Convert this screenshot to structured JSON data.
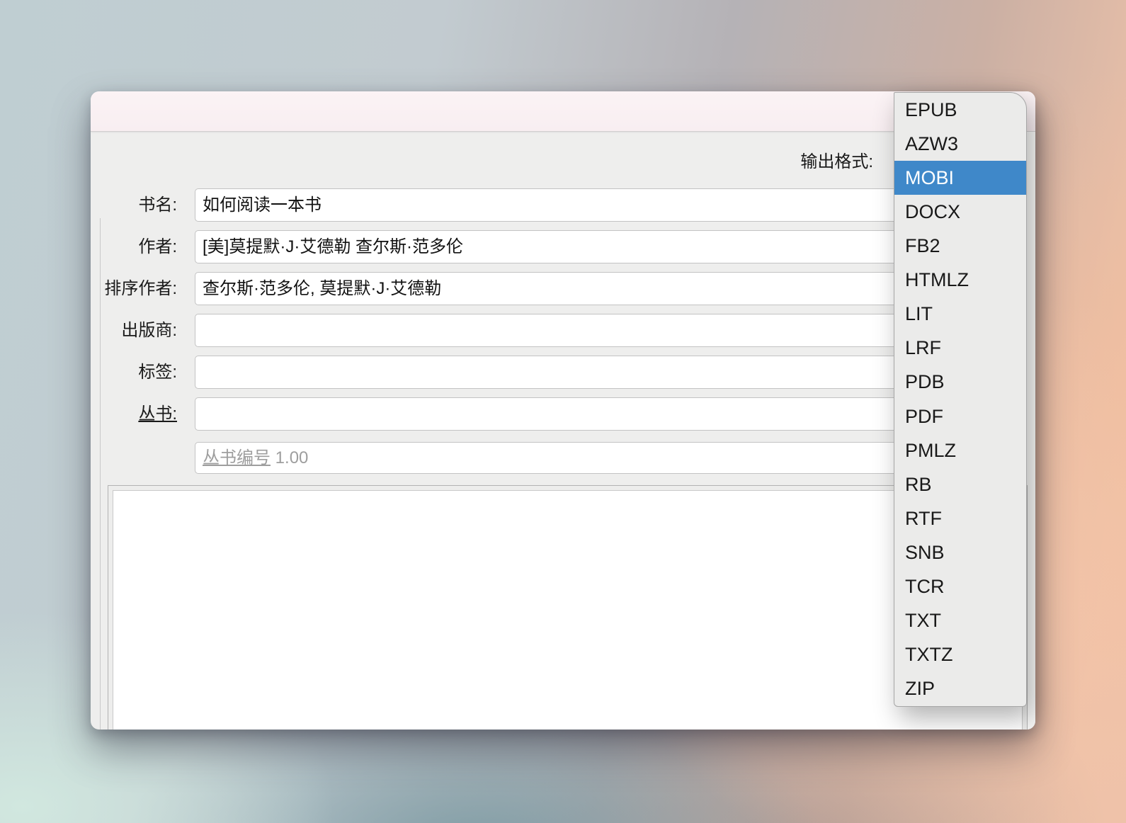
{
  "window": {
    "type": "convert-metadata-dialog",
    "title": ""
  },
  "output_format": {
    "label": "输出格式:",
    "selected": "MOBI",
    "selected_index": 2,
    "options": [
      "EPUB",
      "AZW3",
      "MOBI",
      "DOCX",
      "FB2",
      "HTMLZ",
      "LIT",
      "LRF",
      "PDB",
      "PDF",
      "PMLZ",
      "RB",
      "RTF",
      "SNB",
      "TCR",
      "TXT",
      "TXTZ",
      "ZIP"
    ]
  },
  "form": {
    "rows": [
      {
        "label": "书名:",
        "value": "如何阅读一本书"
      },
      {
        "label": "作者:",
        "value": "[美]莫提默·J·艾德勒 查尔斯·范多伦"
      },
      {
        "label": "排序作者:",
        "value": "查尔斯·范多伦, 莫提默·J·艾德勒"
      },
      {
        "label": "出版商:",
        "value": ""
      },
      {
        "label": "标签:",
        "value": ""
      },
      {
        "label": "丛书:",
        "value": ""
      }
    ],
    "series_number": {
      "placeholder_label": "丛书编号",
      "placeholder_value": "1.00"
    },
    "comments_value": ""
  },
  "colors": {
    "accent_blue": "#3F88C9",
    "titlebar_pink": "#F9F0F2",
    "body_gray": "#EEEEED",
    "popup_gray": "#EBEBEA"
  }
}
